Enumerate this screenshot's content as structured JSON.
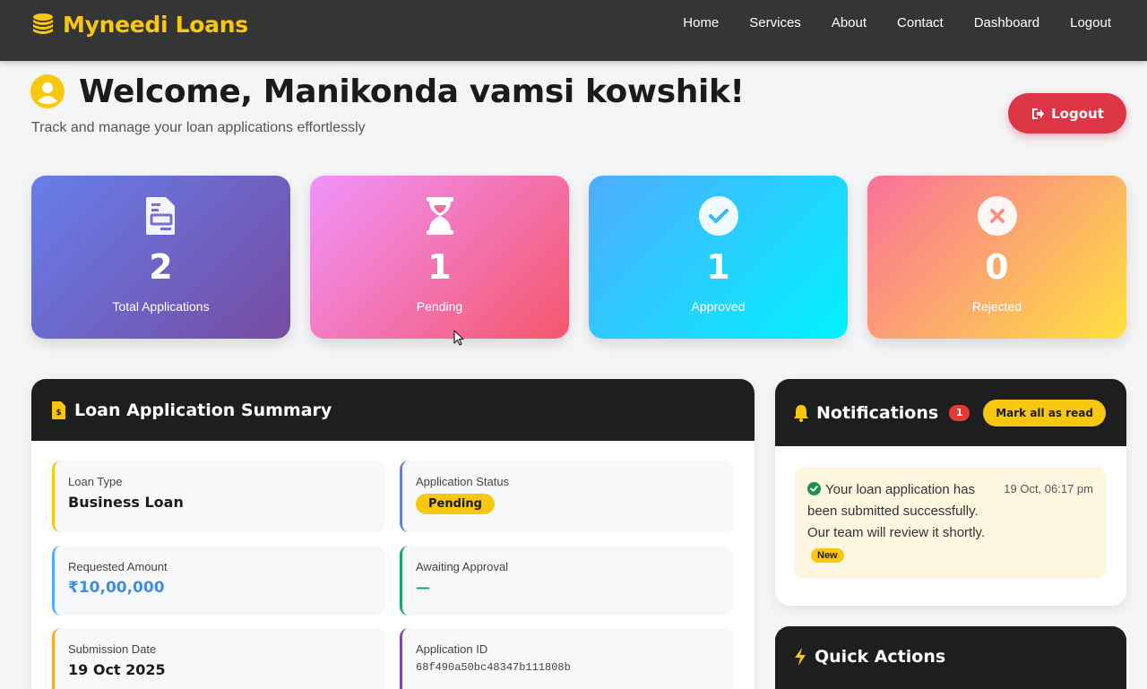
{
  "brand": {
    "name": "Myneedi Loans",
    "color": "#f9c80e",
    "icon": "coins-icon"
  },
  "nav": [
    "Home",
    "Services",
    "About",
    "Contact",
    "Dashboard",
    "Logout"
  ],
  "header": {
    "welcome": "Welcome, Manikonda vamsi kowshik!",
    "subtitle": "Track and manage your loan applications effortlessly",
    "logout_label": "Logout"
  },
  "stats": [
    {
      "value": "2",
      "label": "Total Applications",
      "icon": "file-invoice-icon"
    },
    {
      "value": "1",
      "label": "Pending",
      "icon": "hourglass-icon"
    },
    {
      "value": "1",
      "label": "Approved",
      "icon": "check-circle-icon"
    },
    {
      "value": "0",
      "label": "Rejected",
      "icon": "times-circle-icon"
    }
  ],
  "summary": {
    "title": "Loan Application Summary",
    "loan_type_label": "Loan Type",
    "loan_type": "Business Loan",
    "status_label": "Application Status",
    "status": "Pending",
    "amount_label": "Requested Amount",
    "amount": "₹10,00,000",
    "approval_label": "Awaiting Approval",
    "approval_value": "—",
    "date_label": "Submission Date",
    "date": "19 Oct 2025",
    "id_label": "Application ID",
    "id": "68f490a50bc48347b111808b"
  },
  "notifications": {
    "title": "Notifications",
    "count": "1",
    "mark_all_label": "Mark all as read",
    "items": [
      {
        "text": "Your loan application has been submitted successfully. Our team will review it shortly.",
        "time": "19 Oct, 06:17 pm",
        "badge": "New"
      }
    ]
  },
  "quick_actions": {
    "title": "Quick Actions"
  },
  "colors": {
    "navbar": "#353535",
    "accent": "#f9c80e",
    "danger": "#dc3545",
    "panel_header": "#1e1e1e"
  }
}
